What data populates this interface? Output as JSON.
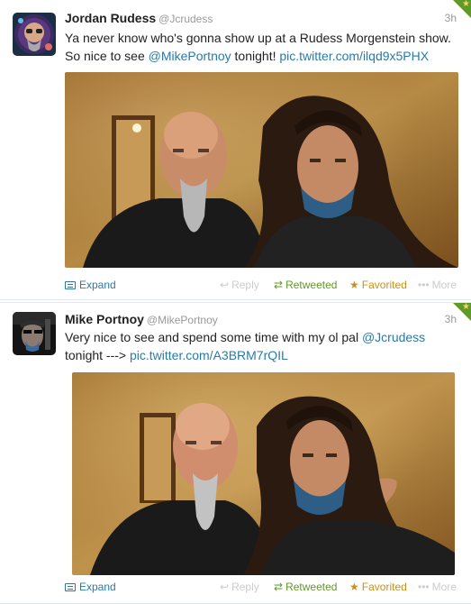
{
  "tweets": [
    {
      "fullname": "Jordan Rudess",
      "username": "@Jcrudess",
      "time": "3h",
      "text_plain": "Ya never know who's gonna show up at a Rudess Morgenstein show. So nice to see ",
      "mention": "@MikePortnoy",
      "text_mid": " tonight! ",
      "link": "pic.twitter.com/ilqd9x5PHX",
      "actions": {
        "expand": "Expand",
        "reply": "Reply",
        "retweet": "Retweeted",
        "favorite": "Favorited",
        "more": "More"
      }
    },
    {
      "fullname": "Mike Portnoy",
      "username": "@MikePortnoy",
      "time": "3h",
      "text_plain": "Very nice to see and spend some time with my ol pal ",
      "mention": "@Jcrudess",
      "text_mid": " tonight ---> ",
      "link": "pic.twitter.com/A3BRM7rQIL",
      "actions": {
        "expand": "Expand",
        "reply": "Reply",
        "retweet": "Retweeted",
        "favorite": "Favorited",
        "more": "More"
      }
    }
  ],
  "icons": {
    "expand": "expand-icon",
    "reply": "reply-icon",
    "retweet": "retweet-icon",
    "favorite": "star-icon",
    "more": "ellipsis-icon"
  },
  "colors": {
    "link": "#2a7aa6",
    "retweeted": "#609928",
    "favorited": "#c89216",
    "muted": "#999999"
  }
}
